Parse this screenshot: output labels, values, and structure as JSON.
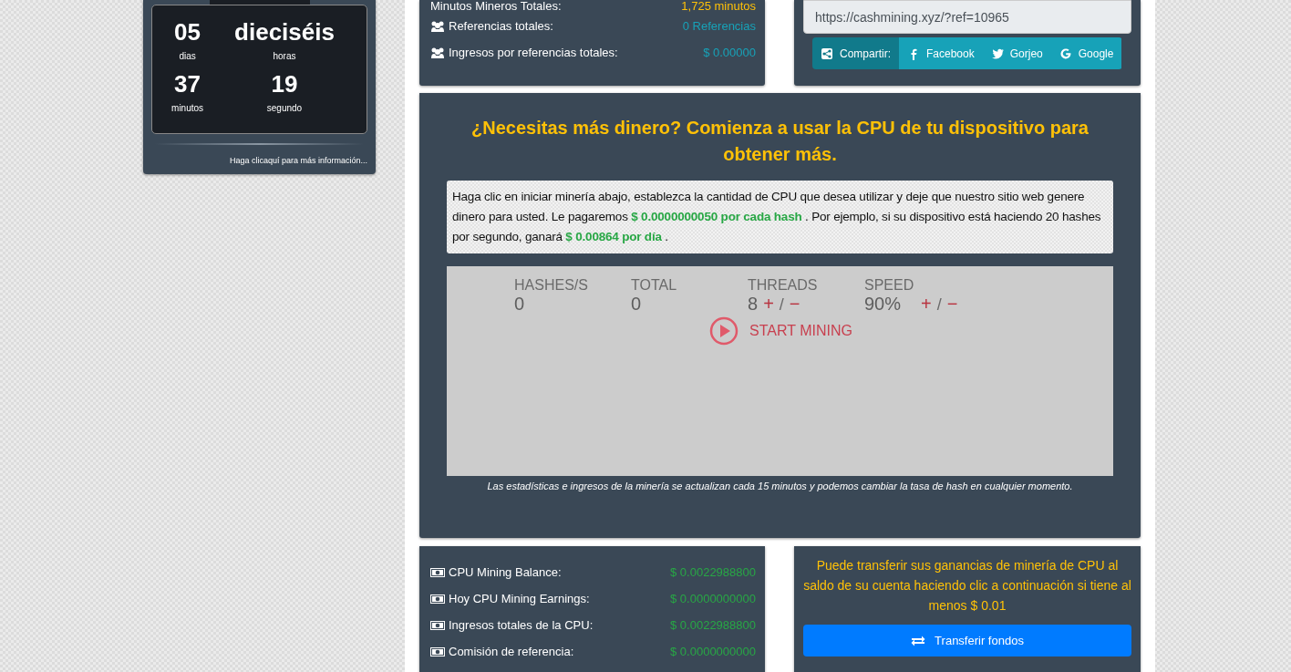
{
  "countdown": {
    "units": [
      {
        "value": "05",
        "label": "dias"
      },
      {
        "value": "dieciséis",
        "label": "horas"
      },
      {
        "value": "37",
        "label": "minutos"
      },
      {
        "value": "19",
        "label": "segundo"
      }
    ],
    "link": "Haga clicaquí para más información..."
  },
  "referral_stats": [
    {
      "label": "Minutos Mineros Totales:",
      "value": "1,725 minutos",
      "color": "#ffc107"
    },
    {
      "label": "Referencias totales:",
      "value": "0 Referencias",
      "color": "#17a2b8"
    },
    {
      "label": "Ingresos por referencias totales:",
      "value": "$ 0.00000",
      "color": "#17a2b8"
    }
  ],
  "share": {
    "url": "https://cashmining.xyz/?ref=10965",
    "buttons": [
      {
        "kind": "share",
        "label": "Compartir:"
      },
      {
        "kind": "facebook",
        "label": "Facebook"
      },
      {
        "kind": "twitter",
        "label": "Gorjeo"
      },
      {
        "kind": "google",
        "label": "Google"
      }
    ]
  },
  "mining": {
    "title": "¿Necesitas más dinero? Comienza a usar la CPU de tu dispositivo para obtener más.",
    "description": "Haga clic en iniciar minería abajo, establezca la cantidad de CPU que desea utilizar y deje que nuestro sitio web genere dinero para usted. Le pagaremos **$ 0.0000000050 por cada hash** . Por ejemplo, si su dispositivo está haciendo 20 hashes por segundo, ganará **$ 0.00864 por día** .",
    "miner": {
      "stats": [
        {
          "label": "HASHES/S",
          "value": "0"
        },
        {
          "label": "TOTAL",
          "value": "0"
        },
        {
          "label": "THREADS",
          "value": "8",
          "plus": "+",
          "slash": "/",
          "minus": "−"
        },
        {
          "label": "SPEED",
          "value": "90%",
          "plus": "+",
          "slash": "/",
          "minus": "−"
        }
      ],
      "start": "START MINING"
    },
    "note": "Las estadísticas e ingresos de la minería se actualizan cada 15 minutos y podemos cambiar la tasa de hash en cualquier momento."
  },
  "balances": [
    {
      "label": "CPU Mining Balance:",
      "value": "$ 0.0022988800"
    },
    {
      "label": "Hoy CPU Mining Earnings:",
      "value": "$ 0.0000000000"
    },
    {
      "label": "Ingresos totales de la CPU:",
      "value": "$ 0.0022988800"
    },
    {
      "label": "Comisión de referencia:",
      "value": "$ 0.0000000000"
    }
  ],
  "transfer": {
    "text": "Puede transferir sus ganancias de minería de CPU al saldo de su cuenta haciendo clic a continuación si tiene al menos $ 0.01",
    "button": "Transferir fondos"
  }
}
